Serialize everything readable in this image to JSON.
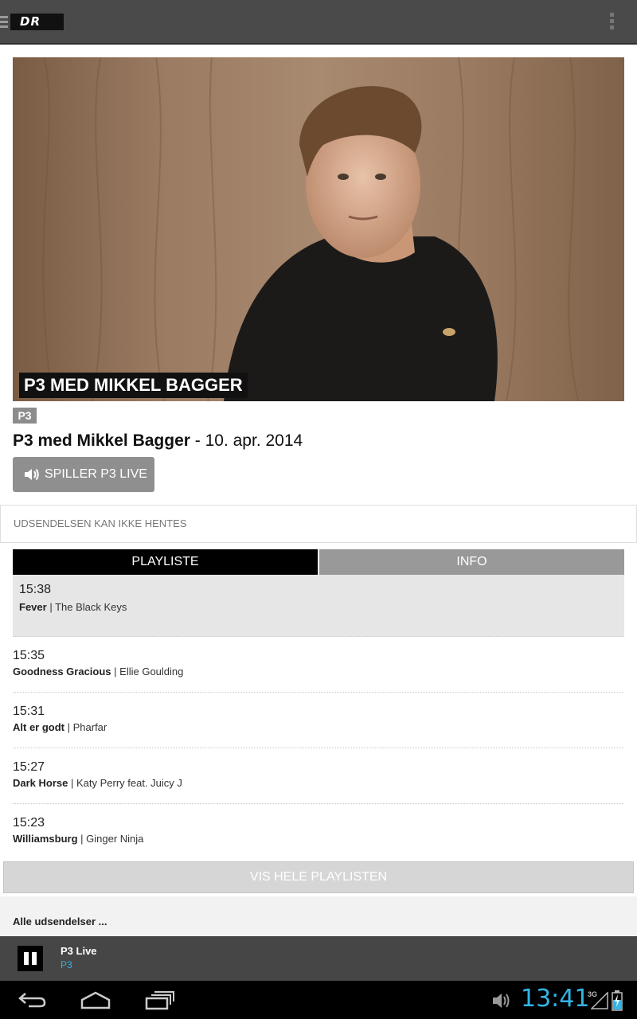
{
  "app_bar": {
    "menu_icon": "hamburger-icon",
    "logo_text": "DR",
    "overflow_icon": "more-vert-icon"
  },
  "hero": {
    "caption": "P3 MED MIKKEL BAGGER"
  },
  "channel_badge": "P3",
  "show": {
    "title": "P3 med Mikkel Bagger",
    "date_separator": " - ",
    "date": "10. apr. 2014"
  },
  "live_button": {
    "icon": "speaker-icon",
    "label": "SPILLER P3 LIVE"
  },
  "notice": "UDSENDELSEN KAN IKKE HENTES",
  "tabs": [
    {
      "label": "PLAYLISTE"
    },
    {
      "label": "INFO"
    }
  ],
  "playlist": [
    {
      "time": "15:38",
      "title": "Fever",
      "artist": "The Black Keys"
    },
    {
      "time": "15:35",
      "title": "Goodness Gracious",
      "artist": "Ellie Goulding"
    },
    {
      "time": "15:31",
      "title": "Alt er godt",
      "artist": "Pharfar"
    },
    {
      "time": "15:27",
      "title": "Dark Horse",
      "artist": "Katy Perry feat. Juicy J"
    },
    {
      "time": "15:23",
      "title": "Williamsburg",
      "artist": "Ginger Ninja"
    }
  ],
  "separator": " | ",
  "show_all_button": "VIS HELE PLAYLISTEN",
  "all_shows_link": "Alle udsendelser ...",
  "player": {
    "title": "P3 Live",
    "subtitle": "P3",
    "pause_icon": "pause-icon"
  },
  "system_bar": {
    "clock": "13:41",
    "network": "3G",
    "accent_color": "#33b5e5"
  }
}
